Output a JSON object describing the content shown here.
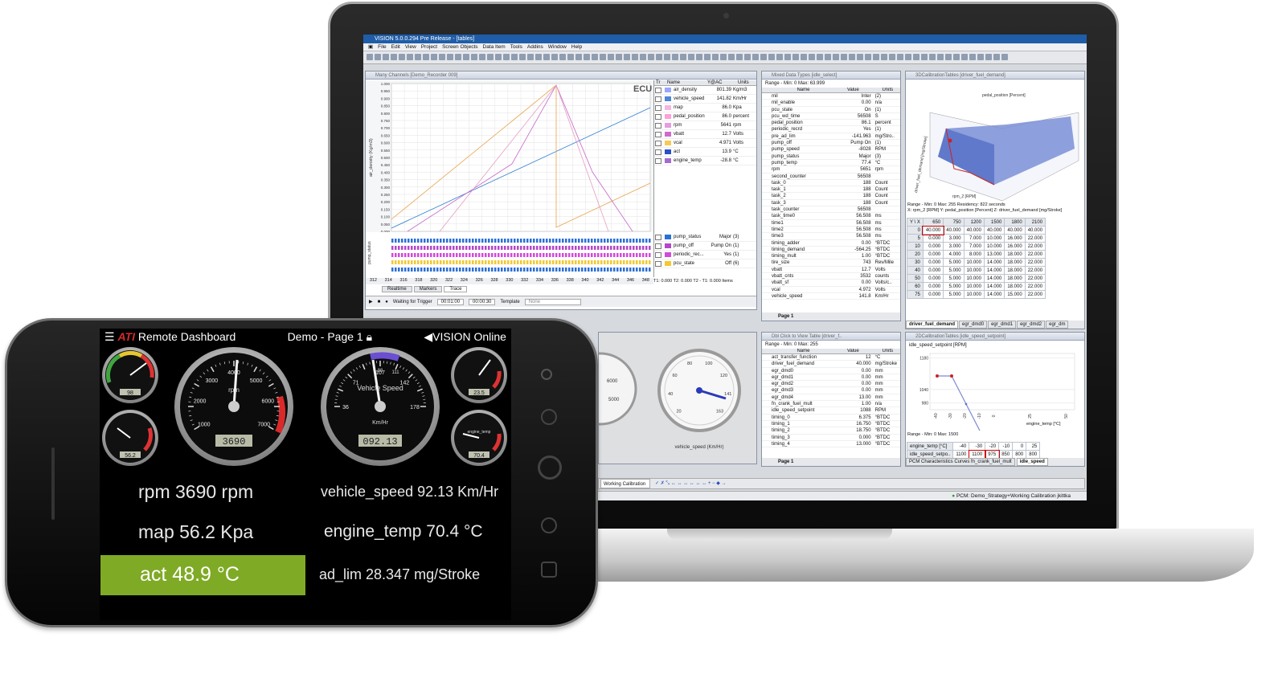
{
  "laptop": {
    "window_title": "VISION 5.0.0.294 Pre Release - [tables]",
    "menu": [
      "File",
      "Edit",
      "View",
      "Project",
      "Screen Objects",
      "Data Item",
      "Tools",
      "Addins",
      "Window",
      "Help"
    ],
    "trace_panel": {
      "title": "Many Channels [Demo_Recorder 009]",
      "watermark": "ECU",
      "y_axis_label": "air_density (Kg/m3)",
      "y_ticks": [
        "1.000",
        "0.950",
        "0.900",
        "0.850",
        "0.800",
        "0.750",
        "0.700",
        "0.650",
        "0.600",
        "0.550",
        "0.500",
        "0.450",
        "0.400",
        "0.350",
        "0.300",
        "0.250",
        "0.200",
        "0.150",
        "0.100",
        "0.050",
        "0.000"
      ],
      "x_ticks": [
        "312",
        "314",
        "316",
        "318",
        "320",
        "322",
        "324",
        "326",
        "328",
        "330",
        "332",
        "334",
        "336",
        "338",
        "340",
        "342",
        "344",
        "346",
        "348"
      ],
      "legend_headers": [
        "Tr",
        "Name",
        "Y@AC",
        "Units"
      ],
      "channels": [
        {
          "name": "air_density",
          "value": "801.39",
          "unit": "Kg/m3",
          "color": "#9aa7ff"
        },
        {
          "name": "vehicle_speed",
          "value": "141.82",
          "unit": "Km/Hr",
          "color": "#4f86d6"
        },
        {
          "name": "map",
          "value": "86.0",
          "unit": "Kpa",
          "color": "#f6b5e0"
        },
        {
          "name": "pedal_position",
          "value": "86.0",
          "unit": "percent",
          "color": "#ff9fd8"
        },
        {
          "name": "rpm",
          "value": "5641",
          "unit": "rpm",
          "color": "#e39de0"
        },
        {
          "name": "vbatt",
          "value": "12.7",
          "unit": "Volts",
          "color": "#cf6bcf"
        },
        {
          "name": "vcal",
          "value": "4.971",
          "unit": "Volts",
          "color": "#f7c957"
        },
        {
          "name": "act",
          "value": "13.9",
          "unit": "°C",
          "color": "#2a50c7"
        },
        {
          "name": "engine_temp",
          "value": "-28.8",
          "unit": "°C",
          "color": "#a36ad1"
        }
      ],
      "logic_channels": [
        {
          "name": "pump_status",
          "value": "Major",
          "unit": "(3)",
          "color": "#2b6fd6"
        },
        {
          "name": "pump_off",
          "value": "Pump On",
          "unit": "(1)",
          "color": "#b347c9"
        },
        {
          "name": "periodic_rec...",
          "value": "Yes",
          "unit": "(1)",
          "color": "#d14ad9"
        },
        {
          "name": "pcu_state",
          "value": "Off",
          "unit": "(6)",
          "color": "#f4c82f"
        }
      ],
      "cursor_info": "T1: 0.000   T2: 0.000   T2 - T1: 0.000 Items",
      "tabs": [
        "Realtime",
        "Markers",
        "Trace"
      ],
      "trigger_status": "Waiting for Trigger",
      "time_a": "00:01:00",
      "time_b": "00:00:30",
      "template_label": "Template",
      "template_value": "None"
    },
    "mixed_panel": {
      "title": "Mixed Data Types [idle_select]",
      "range": "Range - Min: 0   Max: 63.999",
      "headers": [
        "Name",
        "Value",
        "Units"
      ],
      "rows": [
        [
          "mil",
          "Inter",
          "(2)"
        ],
        [
          "mil_enable",
          "0.00",
          "n/a"
        ],
        [
          "pcu_state",
          "On",
          "(1)"
        ],
        [
          "pcu_wd_time",
          "56508",
          "S"
        ],
        [
          "pedal_position",
          "86.1",
          "percent"
        ],
        [
          "periodic_recrd",
          "Yes",
          "(1)"
        ],
        [
          "pre_ad_lim",
          "-141.963",
          "mg/Stro.."
        ],
        [
          "pump_off",
          "Pump On",
          "(1)"
        ],
        [
          "pump_speed",
          "-8028",
          "RPM"
        ],
        [
          "pump_status",
          "Major",
          "(3)"
        ],
        [
          "pump_temp",
          "77.4",
          "°C"
        ],
        [
          "rpm",
          "5651",
          "rpm"
        ],
        [
          "second_counter",
          "56508",
          ""
        ],
        [
          "task_0",
          "188",
          "Count"
        ],
        [
          "task_1",
          "188",
          "Count"
        ],
        [
          "task_2",
          "188",
          "Count"
        ],
        [
          "task_3",
          "188",
          "Count"
        ],
        [
          "task_counter",
          "56508",
          ""
        ],
        [
          "task_time0",
          "56.508",
          "ms"
        ],
        [
          "time1",
          "56.508",
          "ms"
        ],
        [
          "time2",
          "56.508",
          "ms"
        ],
        [
          "time3",
          "56.508",
          "ms"
        ],
        [
          "timing_adder",
          "0.00",
          "°BTDC"
        ],
        [
          "timing_demand",
          "-564.25",
          "°BTDC"
        ],
        [
          "timing_mult",
          "1.00",
          "°BTDC"
        ],
        [
          "tire_size",
          "743",
          "Rev/Mile"
        ],
        [
          "vbatt",
          "12.7",
          "Volts"
        ],
        [
          "vbatt_cnts",
          "3532",
          "counts"
        ],
        [
          "vbatt_sf",
          "0.00",
          "Volts/c.."
        ],
        [
          "vcal",
          "4.972",
          "Volts"
        ],
        [
          "vehicle_speed",
          "141.8",
          "Km/Hr"
        ]
      ],
      "page_tab": "Page 1"
    },
    "map3d_panel": {
      "title": "3DCalibrationTables [driver_fuel_demand]",
      "axis_x": "pedal_position [Percent]",
      "axis_y": "rpm_2 [RPM]",
      "axis_z": "driver_fuel_demand [mg/Stroke]",
      "range": "Range - Min: 0   Max: 255 Residency: 822 seconds",
      "axes_line": "X: rpm_2 [RPM]   Y: pedal_position [Percent]   Z: driver_fuel_demand [mg/Stroke]",
      "corner": "Y \\ X",
      "col_headers": [
        "650",
        "750",
        "1200",
        "1500",
        "1800",
        "2100"
      ],
      "row_headers": [
        "0",
        "5",
        "10",
        "20",
        "30",
        "40",
        "50",
        "60",
        "75"
      ],
      "cells": [
        [
          "40.000",
          "40.000",
          "40.000",
          "40.000",
          "40.000",
          "40.000"
        ],
        [
          "0.000",
          "3.000",
          "7.000",
          "10.000",
          "16.000",
          "22.000"
        ],
        [
          "0.000",
          "3.000",
          "7.000",
          "10.000",
          "16.000",
          "22.000"
        ],
        [
          "0.000",
          "4.000",
          "8.000",
          "13.000",
          "18.000",
          "22.000"
        ],
        [
          "0.000",
          "5.000",
          "10.000",
          "14.000",
          "18.000",
          "22.000"
        ],
        [
          "0.000",
          "5.000",
          "10.000",
          "14.000",
          "18.000",
          "22.000"
        ],
        [
          "0.000",
          "5.000",
          "10.000",
          "14.000",
          "18.000",
          "22.000"
        ],
        [
          "0.000",
          "5.000",
          "10.000",
          "14.000",
          "18.000",
          "22.000"
        ],
        [
          "0.000",
          "5.000",
          "10.000",
          "14.000",
          "15.000",
          "22.000"
        ]
      ],
      "tabs": [
        "driver_fuel_demand",
        "egr_dmd0",
        "egr_dmd1",
        "egr_dmd2",
        "egr_dm"
      ]
    },
    "gauges_panel": {
      "gauge_label": "vehicle_speed (Km/Hr)",
      "ticks": [
        "20",
        "40",
        "60",
        "80",
        "100",
        "120",
        "141",
        "163"
      ],
      "left_ticks": [
        "6000",
        "5000"
      ]
    },
    "dbl_panel": {
      "title": "Dbl Click to View Table [driver_f..",
      "range": "Range - Min: 0   Max: 255",
      "headers": [
        "Name",
        "Value",
        "Units"
      ],
      "rows": [
        [
          "act_transfer_function",
          "12",
          "°C"
        ],
        [
          "driver_fuel_demand",
          "40.000",
          "mg/Stroke"
        ],
        [
          "egr_dmd0",
          "0.00",
          "mm"
        ],
        [
          "egr_dmd1",
          "0.00",
          "mm"
        ],
        [
          "egr_dmd2",
          "0.00",
          "mm"
        ],
        [
          "egr_dmd3",
          "0.00",
          "mm"
        ],
        [
          "egr_dmd4",
          "13.00",
          "mm"
        ],
        [
          "fn_crank_fuel_mult",
          "1.00",
          "n/a"
        ],
        [
          "idle_speed_setpoint",
          "1088",
          "RPM"
        ],
        [
          "timing_0",
          "6.375",
          "°BTDC"
        ],
        [
          "timing_1",
          "16.750",
          "°BTDC"
        ],
        [
          "timing_2",
          "18.750",
          "°BTDC"
        ],
        [
          "timing_3",
          "0.000",
          "°BTDC"
        ],
        [
          "timing_4",
          "13.000",
          "°BTDC"
        ]
      ],
      "page_tab": "Page 1"
    },
    "curve_panel": {
      "title": "2DCalibrationTables [idle_speed_setpoint]",
      "y_label": "idle_speed_setpoint [RPM]",
      "x_label": "engine_temp [°C]",
      "y_ticks": [
        "1180",
        "1040",
        "980"
      ],
      "x_ticks": [
        "-40",
        "-30",
        "-20",
        "-10",
        "0",
        "25",
        "50"
      ],
      "range": "Range - Min: 0   Max: 1500",
      "row_x": [
        "engine_temp [°C]",
        "-40",
        "-30",
        "-20",
        "-10",
        "0",
        "25"
      ],
      "row_y": [
        "idle_speed_setpo..",
        "1100",
        "1100",
        "975",
        "850",
        "800",
        "800"
      ],
      "tabs": [
        "PCM Characteristics Curves fn_crank_fuel_mult",
        "idle_speed"
      ],
      "curve": [
        {
          "x": -40,
          "y": 1100
        },
        {
          "x": -30,
          "y": 1100
        },
        {
          "x": -20,
          "y": 975
        },
        {
          "x": -10,
          "y": 850
        },
        {
          "x": 0,
          "y": 800
        },
        {
          "x": 25,
          "y": 800
        },
        {
          "x": 50,
          "y": 800
        }
      ]
    },
    "bottom_toolbar_label": "Working Calibration",
    "status": "PCM: Demo_Strategy+Working Calibration   jkittka"
  },
  "phone": {
    "header": {
      "brand": "ATI",
      "app_title": "Remote Dashboard",
      "page": "Demo - Page 1",
      "status": "VISION Online"
    },
    "rpm_gauge": {
      "ticks": [
        "1000",
        "2000",
        "3000",
        "4000",
        "5000",
        "6000",
        "7000"
      ],
      "label": "rpm",
      "readout": "3690"
    },
    "speed_gauge": {
      "label": "Vehicle Speed",
      "unit": "Km/Hr",
      "ticks": [
        "36",
        "71",
        "107",
        "142",
        "178"
      ],
      "readout": "092.13",
      "top_ticks": [
        "88",
        "111"
      ]
    },
    "small_gauge_labels": {
      "top_left_readout": "98",
      "bottom_left_readout": "56.2",
      "top_right_readout": "23.5",
      "bottom_right_label": "engine_temp",
      "bottom_right_readout": "70.4"
    },
    "values": {
      "rpm": "rpm 3690 rpm",
      "vehicle_speed": "vehicle_speed 92.13 Km/Hr",
      "map": "map 56.2 Kpa",
      "engine_temp": "engine_temp 70.4 °C",
      "act": "act 48.9 °C",
      "ad_lim": "ad_lim 28.347 mg/Stroke"
    },
    "highlight_color": "#7faa26"
  }
}
